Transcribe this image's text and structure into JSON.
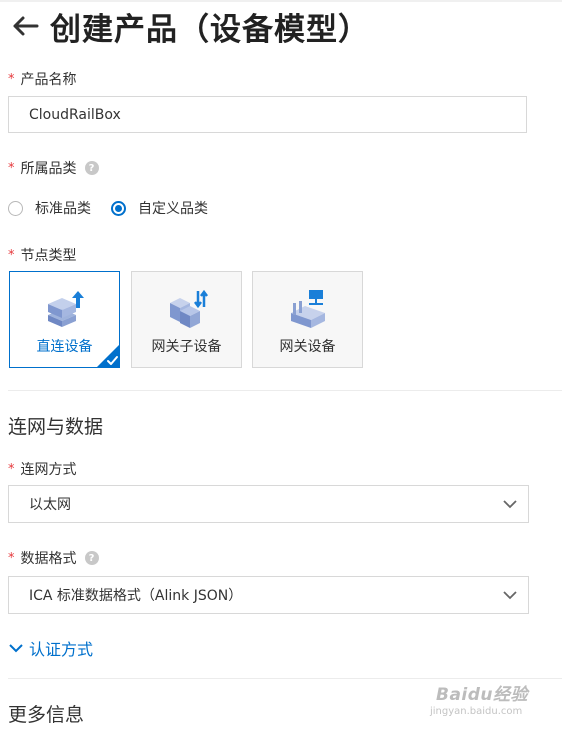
{
  "header": {
    "title": "创建产品（设备模型）"
  },
  "form": {
    "required_mark": "*",
    "product_name": {
      "label": "产品名称",
      "value": "CloudRailBox"
    },
    "category": {
      "label": "所属品类",
      "help": "?",
      "options": [
        {
          "label": "标准品类",
          "selected": false
        },
        {
          "label": "自定义品类",
          "selected": true
        }
      ]
    },
    "node_type": {
      "label": "节点类型",
      "options": [
        {
          "label": "直连设备",
          "icon": "direct-device-icon",
          "selected": true
        },
        {
          "label": "网关子设备",
          "icon": "gateway-subdevice-icon",
          "selected": false
        },
        {
          "label": "网关设备",
          "icon": "gateway-device-icon",
          "selected": false
        }
      ]
    }
  },
  "network": {
    "section_title": "连网与数据",
    "method": {
      "label": "连网方式",
      "value": "以太网"
    },
    "data_format": {
      "label": "数据格式",
      "help": "?",
      "value": "ICA 标准数据格式（Alink JSON）"
    },
    "auth_toggle": "认证方式"
  },
  "more": {
    "section_title": "更多信息"
  },
  "watermark": {
    "text": "Baidu经验",
    "sub": "jingyan.baidu.com"
  },
  "colors": {
    "accent": "#0070cc",
    "required": "#e5373b",
    "border": "#d8d8d8"
  }
}
